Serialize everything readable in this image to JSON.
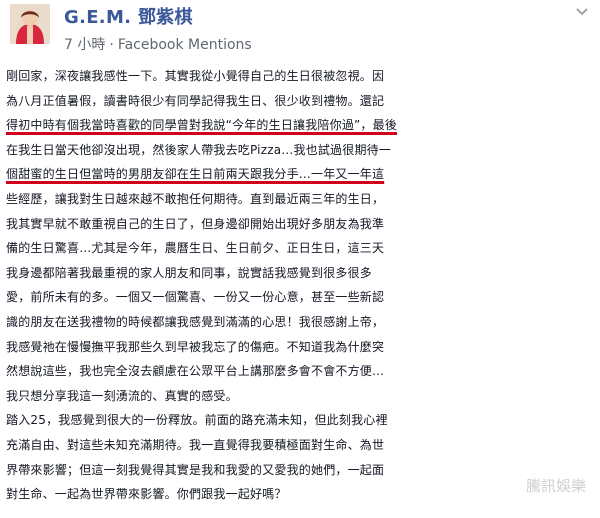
{
  "header": {
    "author": "G.E.M. 鄧紫棋",
    "time": "7 小時",
    "separator": "·",
    "source": "Facebook Mentions"
  },
  "icons": {
    "menu": "chevron-down-icon",
    "globe": "globe-icon"
  },
  "post": {
    "lines": [
      "剛回家，深夜讓我感性一下。其實我從小覺得自己的生日很被忽視。因",
      "為八月正值暑假，讀書時很少有同學記得我生日、很少收到禮物。還記",
      "得初中時有個我當時喜歡的同學曾對我說“今年的生日讓我陪你過”，最後",
      "在我生日當天他卻沒出現，然後家人帶我去吃Pizza…我也試過很期待一",
      "個甜蜜的生日但當時的男朋友卻在生日前兩天跟我分手…一年又一年這",
      "些經歷，讓我對生日越來越不敢抱任何期待。直到最近兩三年的生日，",
      "我其實早就不敢重視自己的生日了，但身邊卻開始出現好多朋友為我準",
      "備的生日驚喜…尤其是今年，農曆生日、生日前夕、正日生日，這三天",
      "我身邊都陪著我最重視的家人朋友和同事，說實話我感覺到很多很多",
      "愛，前所未有的多。一個又一個驚喜、一份又一份心意，甚至一些新認",
      "識的朋友在送我禮物的時候都讓我感覺到滿滿的心思！我很感謝上帝，",
      "我感覺祂在慢慢撫平我那些久到早被我忘了的傷疤。不知道我為什麼突",
      "然想說這些，我也完全沒去顧慮在公眾平台上講那麼多會不會不方便…",
      "我只想分享我這一刻湧流的、真實的感受。",
      "踏入25，我感覺到很大的一份釋放。前面的路充滿未知，但此刻我心裡",
      "充滿自由、對這些未知充滿期待。我一直覺得我要積極面對生命、為世",
      "界帶來影響；但這一刻我覺得其實是我和我愛的又愛我的她們，一起面",
      "對生命、一起為世界帶來影響。你們跟我一起好嗎？"
    ]
  },
  "watermark": "騰訊娛樂",
  "colors": {
    "author_link": "#3b5998",
    "underline": "#d0021b",
    "meta": "#616770"
  }
}
